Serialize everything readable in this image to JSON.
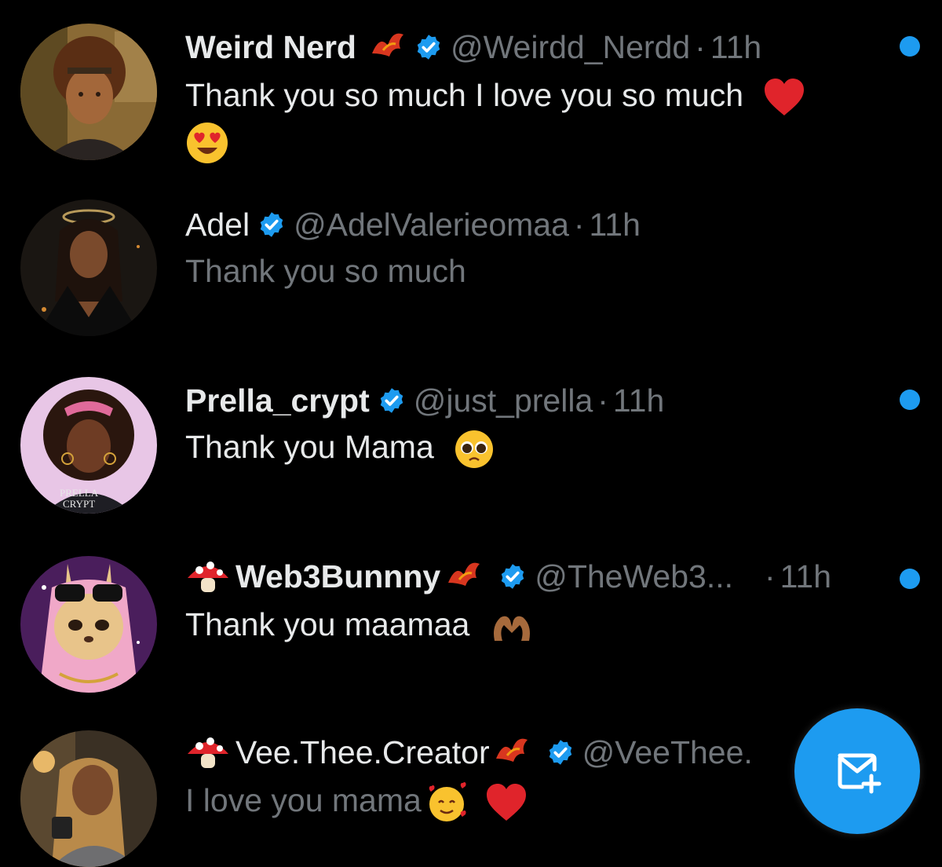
{
  "conversations": [
    {
      "name": "Weird Nerd",
      "handle": "@Weirdd_Nerdd",
      "separator": "·",
      "time": "11h",
      "message": "Thank you so much I love you so much",
      "unread": true
    },
    {
      "name": "Adel",
      "handle": "@AdelValerieomaa",
      "separator": "·",
      "time": "11h",
      "message": "Thank you so much",
      "unread": false
    },
    {
      "name": "Prella_crypt",
      "handle": "@just_prella",
      "separator": "·",
      "time": "11h",
      "message": "Thank you Mama",
      "unread": true,
      "avatar_text_1": "PRELLA",
      "avatar_text_2": "CRYPT"
    },
    {
      "name": "Web3Bunnny",
      "handle": "@TheWeb3...",
      "separator": "·",
      "time": "11h",
      "message": "Thank you maamaa",
      "unread": true
    },
    {
      "name": "Vee.Thee.Creator",
      "handle": "@VeeThee.",
      "message": "I love you mama",
      "unread": false
    }
  ],
  "colors": {
    "accent": "#1d9bf0",
    "background": "#000000",
    "muted": "#71767b",
    "text": "#e7e9ea"
  },
  "icons": {
    "verified": "verified-badge-icon",
    "compose": "new-message-icon",
    "unread": "unread-dot"
  }
}
